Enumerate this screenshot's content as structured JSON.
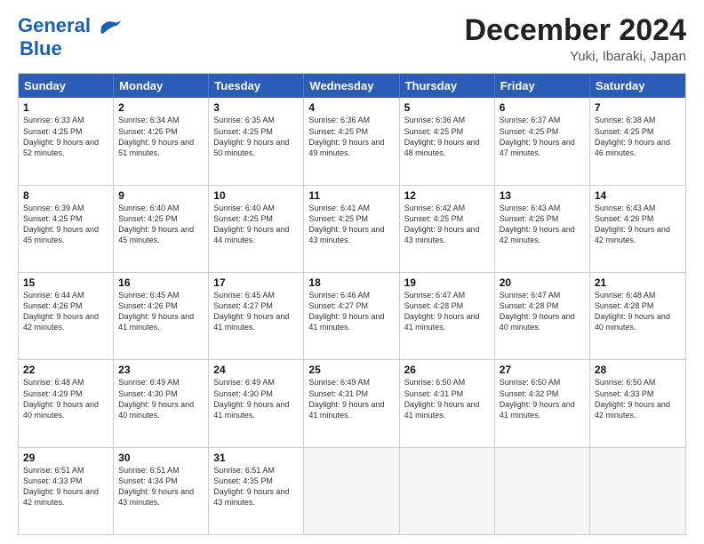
{
  "header": {
    "logo_line1": "General",
    "logo_line2": "Blue",
    "month": "December 2024",
    "location": "Yuki, Ibaraki, Japan"
  },
  "weekdays": [
    "Sunday",
    "Monday",
    "Tuesday",
    "Wednesday",
    "Thursday",
    "Friday",
    "Saturday"
  ],
  "rows": [
    [
      {
        "day": "1",
        "rise": "Sunrise: 6:33 AM",
        "set": "Sunset: 4:25 PM",
        "daylight": "Daylight: 9 hours and 52 minutes."
      },
      {
        "day": "2",
        "rise": "Sunrise: 6:34 AM",
        "set": "Sunset: 4:25 PM",
        "daylight": "Daylight: 9 hours and 51 minutes."
      },
      {
        "day": "3",
        "rise": "Sunrise: 6:35 AM",
        "set": "Sunset: 4:25 PM",
        "daylight": "Daylight: 9 hours and 50 minutes."
      },
      {
        "day": "4",
        "rise": "Sunrise: 6:36 AM",
        "set": "Sunset: 4:25 PM",
        "daylight": "Daylight: 9 hours and 49 minutes."
      },
      {
        "day": "5",
        "rise": "Sunrise: 6:36 AM",
        "set": "Sunset: 4:25 PM",
        "daylight": "Daylight: 9 hours and 48 minutes."
      },
      {
        "day": "6",
        "rise": "Sunrise: 6:37 AM",
        "set": "Sunset: 4:25 PM",
        "daylight": "Daylight: 9 hours and 47 minutes."
      },
      {
        "day": "7",
        "rise": "Sunrise: 6:38 AM",
        "set": "Sunset: 4:25 PM",
        "daylight": "Daylight: 9 hours and 46 minutes."
      }
    ],
    [
      {
        "day": "8",
        "rise": "Sunrise: 6:39 AM",
        "set": "Sunset: 4:25 PM",
        "daylight": "Daylight: 9 hours and 45 minutes."
      },
      {
        "day": "9",
        "rise": "Sunrise: 6:40 AM",
        "set": "Sunset: 4:25 PM",
        "daylight": "Daylight: 9 hours and 45 minutes."
      },
      {
        "day": "10",
        "rise": "Sunrise: 6:40 AM",
        "set": "Sunset: 4:25 PM",
        "daylight": "Daylight: 9 hours and 44 minutes."
      },
      {
        "day": "11",
        "rise": "Sunrise: 6:41 AM",
        "set": "Sunset: 4:25 PM",
        "daylight": "Daylight: 9 hours and 43 minutes."
      },
      {
        "day": "12",
        "rise": "Sunrise: 6:42 AM",
        "set": "Sunset: 4:25 PM",
        "daylight": "Daylight: 9 hours and 43 minutes."
      },
      {
        "day": "13",
        "rise": "Sunrise: 6:43 AM",
        "set": "Sunset: 4:26 PM",
        "daylight": "Daylight: 9 hours and 42 minutes."
      },
      {
        "day": "14",
        "rise": "Sunrise: 6:43 AM",
        "set": "Sunset: 4:26 PM",
        "daylight": "Daylight: 9 hours and 42 minutes."
      }
    ],
    [
      {
        "day": "15",
        "rise": "Sunrise: 6:44 AM",
        "set": "Sunset: 4:26 PM",
        "daylight": "Daylight: 9 hours and 42 minutes."
      },
      {
        "day": "16",
        "rise": "Sunrise: 6:45 AM",
        "set": "Sunset: 4:26 PM",
        "daylight": "Daylight: 9 hours and 41 minutes."
      },
      {
        "day": "17",
        "rise": "Sunrise: 6:45 AM",
        "set": "Sunset: 4:27 PM",
        "daylight": "Daylight: 9 hours and 41 minutes."
      },
      {
        "day": "18",
        "rise": "Sunrise: 6:46 AM",
        "set": "Sunset: 4:27 PM",
        "daylight": "Daylight: 9 hours and 41 minutes."
      },
      {
        "day": "19",
        "rise": "Sunrise: 6:47 AM",
        "set": "Sunset: 4:28 PM",
        "daylight": "Daylight: 9 hours and 41 minutes."
      },
      {
        "day": "20",
        "rise": "Sunrise: 6:47 AM",
        "set": "Sunset: 4:28 PM",
        "daylight": "Daylight: 9 hours and 40 minutes."
      },
      {
        "day": "21",
        "rise": "Sunrise: 6:48 AM",
        "set": "Sunset: 4:28 PM",
        "daylight": "Daylight: 9 hours and 40 minutes."
      }
    ],
    [
      {
        "day": "22",
        "rise": "Sunrise: 6:48 AM",
        "set": "Sunset: 4:29 PM",
        "daylight": "Daylight: 9 hours and 40 minutes."
      },
      {
        "day": "23",
        "rise": "Sunrise: 6:49 AM",
        "set": "Sunset: 4:30 PM",
        "daylight": "Daylight: 9 hours and 40 minutes."
      },
      {
        "day": "24",
        "rise": "Sunrise: 6:49 AM",
        "set": "Sunset: 4:30 PM",
        "daylight": "Daylight: 9 hours and 41 minutes."
      },
      {
        "day": "25",
        "rise": "Sunrise: 6:49 AM",
        "set": "Sunset: 4:31 PM",
        "daylight": "Daylight: 9 hours and 41 minutes."
      },
      {
        "day": "26",
        "rise": "Sunrise: 6:50 AM",
        "set": "Sunset: 4:31 PM",
        "daylight": "Daylight: 9 hours and 41 minutes."
      },
      {
        "day": "27",
        "rise": "Sunrise: 6:50 AM",
        "set": "Sunset: 4:32 PM",
        "daylight": "Daylight: 9 hours and 41 minutes."
      },
      {
        "day": "28",
        "rise": "Sunrise: 6:50 AM",
        "set": "Sunset: 4:33 PM",
        "daylight": "Daylight: 9 hours and 42 minutes."
      }
    ],
    [
      {
        "day": "29",
        "rise": "Sunrise: 6:51 AM",
        "set": "Sunset: 4:33 PM",
        "daylight": "Daylight: 9 hours and 42 minutes."
      },
      {
        "day": "30",
        "rise": "Sunrise: 6:51 AM",
        "set": "Sunset: 4:34 PM",
        "daylight": "Daylight: 9 hours and 43 minutes."
      },
      {
        "day": "31",
        "rise": "Sunrise: 6:51 AM",
        "set": "Sunset: 4:35 PM",
        "daylight": "Daylight: 9 hours and 43 minutes."
      },
      {
        "day": "",
        "rise": "",
        "set": "",
        "daylight": ""
      },
      {
        "day": "",
        "rise": "",
        "set": "",
        "daylight": ""
      },
      {
        "day": "",
        "rise": "",
        "set": "",
        "daylight": ""
      },
      {
        "day": "",
        "rise": "",
        "set": "",
        "daylight": ""
      }
    ]
  ]
}
